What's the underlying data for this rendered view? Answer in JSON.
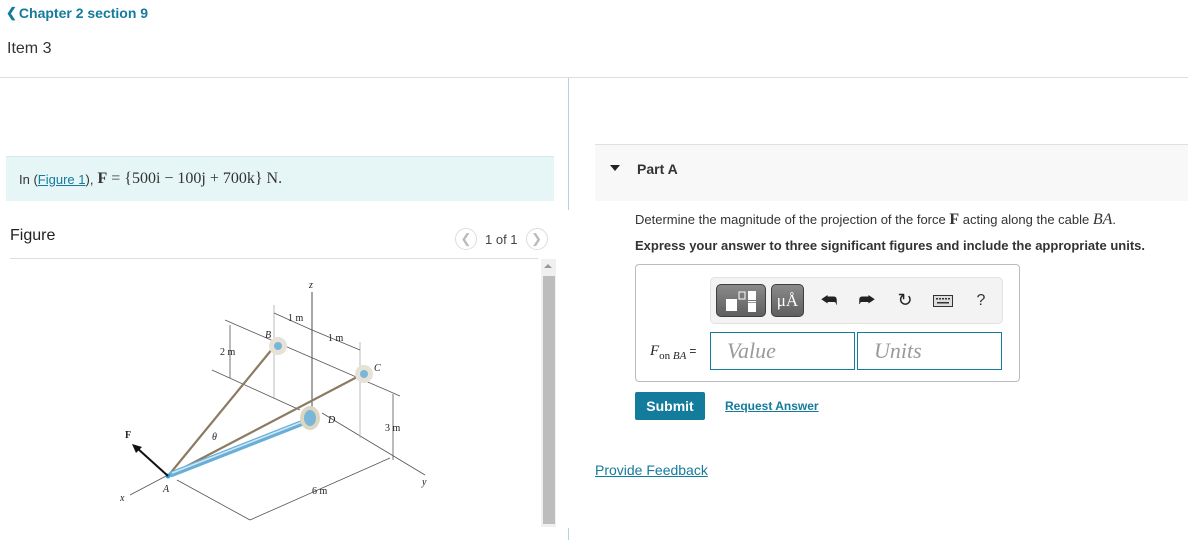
{
  "nav": {
    "back_label": "Chapter 2 section 9",
    "back_icon": "chevron-left-icon",
    "item_title": "Item 3"
  },
  "intro": {
    "prefix": "In (",
    "figure_link": "Figure 1",
    "suffix": "),",
    "equation_lhs": "F",
    "equation_rhs": "= {500i − 100j + 700k} N."
  },
  "figure": {
    "label": "Figure",
    "pager_text": "1 of 1",
    "prev_icon": "chevron-left-icon",
    "next_icon": "chevron-right-icon",
    "diagram_labels": {
      "z_axis": "z",
      "x_axis": "x",
      "y_axis": "y",
      "point_a": "A",
      "point_b": "B",
      "point_c": "C",
      "point_d": "D",
      "force": "F",
      "angle": "θ",
      "dim_1m_left": "1 m",
      "dim_1m_right": "1 m",
      "dim_2m": "2 m",
      "dim_3m": "3 m",
      "dim_6m": "6 m"
    }
  },
  "part": {
    "title": "Part A",
    "question_prefix": "Determine the magnitude of the projection of the force ",
    "question_force": "F",
    "question_mid": " acting along the cable ",
    "question_cable": "BA",
    "question_end": ".",
    "instruction": "Express your answer to three significant figures and include the appropriate units.",
    "answer_label_main": "F",
    "answer_label_sub": "on",
    "answer_label_sub_var": "BA",
    "answer_label_eq": "=",
    "value_placeholder": "Value",
    "units_placeholder": "Units",
    "toolbar": {
      "templates_icon": "templates-icon",
      "units_label": "μÅ",
      "undo_icon": "undo-icon",
      "redo_icon": "redo-icon",
      "reset_icon": "reset-icon",
      "keyboard_icon": "keyboard-icon",
      "help_label": "?"
    },
    "submit_label": "Submit",
    "request_answer_label": "Request Answer"
  },
  "footer": {
    "feedback_label": "Provide Feedback"
  },
  "colors": {
    "accent": "#137b9b",
    "intro_bg": "#e6f5f6",
    "part_header_bg": "#f8f8f8"
  }
}
